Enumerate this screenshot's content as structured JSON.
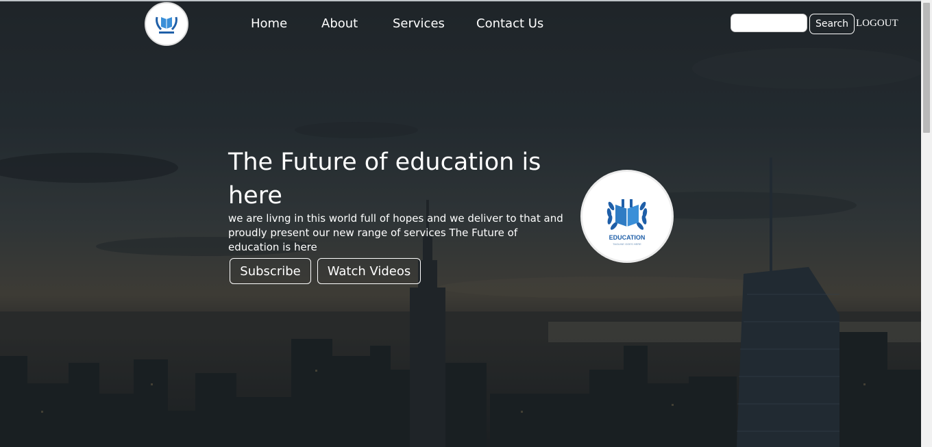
{
  "nav": {
    "links": [
      "Home",
      "About",
      "Services",
      "Contact Us"
    ],
    "search_placeholder": "",
    "search_label": "Search",
    "logout_label": "LOGOUT"
  },
  "logo": {
    "text": "EDUCATION",
    "tagline": "TAGLINE GOES HERE",
    "color": "#1f5fa8"
  },
  "hero": {
    "title": "The Future of education is here",
    "description": "we are livng in this world full of hopes and we deliver to that and proudly present our new range of services The Future of education is here",
    "buttons": [
      "Subscribe",
      "Watch Videos"
    ]
  }
}
